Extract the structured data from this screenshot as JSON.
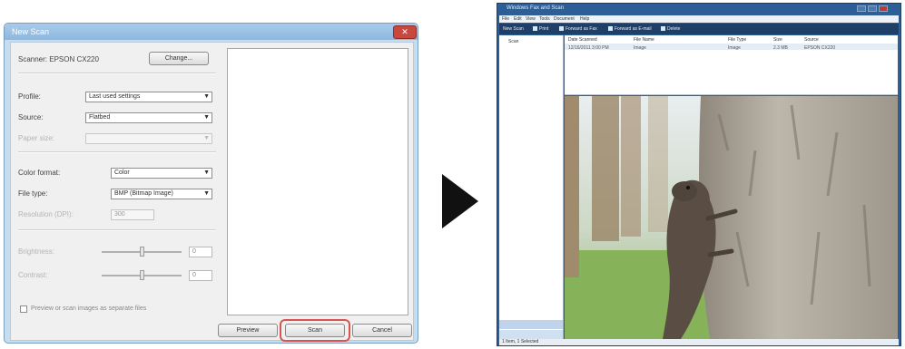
{
  "dialog": {
    "title": "New Scan",
    "close_glyph": "✕",
    "scanner_label": "Scanner: EPSON CX220",
    "change_button": "Change...",
    "profile_label": "Profile:",
    "profile_value": "Last used settings",
    "source_label": "Source:",
    "source_value": "Flatbed",
    "paper_size_label": "Paper size:",
    "paper_size_value": "",
    "color_format_label": "Color format:",
    "color_format_value": "Color",
    "file_type_label": "File type:",
    "file_type_value": "BMP (Bitmap Image)",
    "resolution_label": "Resolution (DPI):",
    "resolution_value": "300",
    "brightness_label": "Brightness:",
    "brightness_value": "0",
    "contrast_label": "Contrast:",
    "contrast_value": "0",
    "preview_checkbox_label": "Preview or scan images as separate files",
    "preview_button": "Preview",
    "scan_button": "Scan",
    "cancel_button": "Cancel",
    "highlight_color": "#d9534f"
  },
  "arrow": {
    "icon": "right-triangle-arrow",
    "color": "#111111"
  },
  "gallery": {
    "title": "Windows Fax and Scan",
    "menu": [
      "File",
      "Edit",
      "View",
      "Tools",
      "Document",
      "Help"
    ],
    "toolbar": [
      "New Scan",
      "Print",
      "Forward as Fax",
      "Forward as E-mail",
      "Delete"
    ],
    "nav_item": "Scan",
    "list_headers": [
      "Date Scanned",
      "File Name",
      "File Type",
      "Size",
      "Source"
    ],
    "list_row": [
      "12/16/2011 3:00 PM",
      "Image",
      "Image",
      "2.3 MB",
      "EPSON CX220"
    ],
    "status": "1 Item, 1 Selected"
  }
}
